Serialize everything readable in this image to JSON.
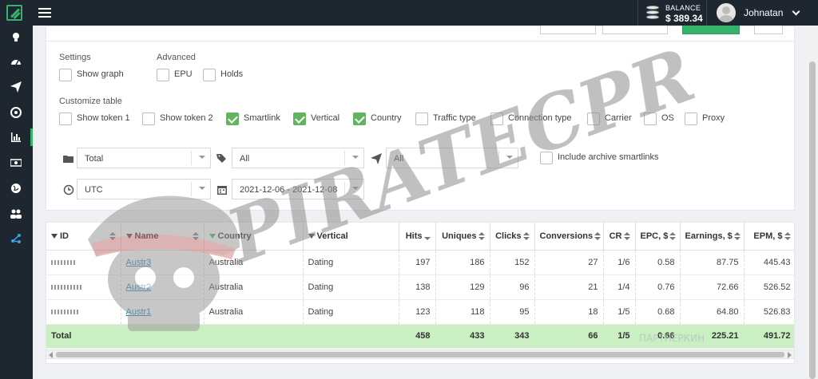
{
  "topbar": {
    "balance_label": "BALANCE",
    "balance_value": "$ 389.34",
    "user_name": "Johnatan"
  },
  "sidebar": {
    "items": [
      {
        "icon": "bulb-icon"
      },
      {
        "icon": "dashboard-icon"
      },
      {
        "icon": "send-icon"
      },
      {
        "icon": "target-icon"
      },
      {
        "icon": "chart-icon",
        "active": true
      },
      {
        "icon": "money-icon"
      },
      {
        "icon": "globe-icon"
      },
      {
        "icon": "users-icon"
      },
      {
        "icon": "share-icon"
      }
    ]
  },
  "panel": {
    "settings_label": "Settings",
    "advanced_label": "Advanced",
    "customize_label": "Customize table",
    "settings_checks": [
      {
        "label": "Show graph",
        "checked": false
      }
    ],
    "advanced_checks": [
      {
        "label": "EPU",
        "checked": false
      },
      {
        "label": "Holds",
        "checked": false
      }
    ],
    "customize_checks": [
      {
        "label": "Show token 1",
        "checked": false
      },
      {
        "label": "Show token 2",
        "checked": false
      },
      {
        "label": "Smartlink",
        "checked": true
      },
      {
        "label": "Vertical",
        "checked": true
      },
      {
        "label": "Country",
        "checked": true
      },
      {
        "label": "Traffic type",
        "checked": false
      },
      {
        "label": "Connection type",
        "checked": false
      },
      {
        "label": "Carrier",
        "checked": false
      },
      {
        "label": "OS",
        "checked": false
      },
      {
        "label": "Proxy",
        "checked": false
      }
    ]
  },
  "filters": {
    "folder_value": "Total",
    "tags_value": "All",
    "send_value": "All",
    "include_archive_label": "Include archive smartlinks",
    "timezone_value": "UTC",
    "date_range_value": "2021-12-06 - 2021-12-08"
  },
  "table": {
    "headers": [
      "ID",
      "Name",
      "Country",
      "Vertical",
      "Hits",
      "Uniques",
      "Clicks",
      "Conversions",
      "CR",
      "EPC, $",
      "Earnings, $",
      "EPM, $"
    ],
    "rows": [
      {
        "name": "Austr3",
        "country": "Australia",
        "vertical": "Dating",
        "hits": "197",
        "uniques": "186",
        "clicks": "152",
        "conversions": "27",
        "cr": "1/6",
        "epc": "0.58",
        "earnings": "87.75",
        "epm": "445.43"
      },
      {
        "name": "Austr2",
        "country": "Australia",
        "vertical": "Dating",
        "hits": "138",
        "uniques": "129",
        "clicks": "96",
        "conversions": "21",
        "cr": "1/4",
        "epc": "0.76",
        "earnings": "72.66",
        "epm": "526.52"
      },
      {
        "name": "Austr1",
        "country": "Australia",
        "vertical": "Dating",
        "hits": "123",
        "uniques": "118",
        "clicks": "95",
        "conversions": "18",
        "cr": "1/5",
        "epc": "0.68",
        "earnings": "64.80",
        "epm": "526.83"
      }
    ],
    "total": {
      "label": "Total",
      "hits": "458",
      "uniques": "433",
      "clicks": "343",
      "conversions": "66",
      "cr": "1/5",
      "epc": "0.66",
      "earnings": "225.21",
      "epm": "491.72"
    }
  },
  "watermark": {
    "text": "PIRATECPR",
    "corner_text": "ПАРТНЕРКИН"
  },
  "colors": {
    "sidebar": "#1e2630",
    "accent": "#35b36b",
    "total_row": "#c9efc2",
    "link": "#1a7ac1"
  }
}
